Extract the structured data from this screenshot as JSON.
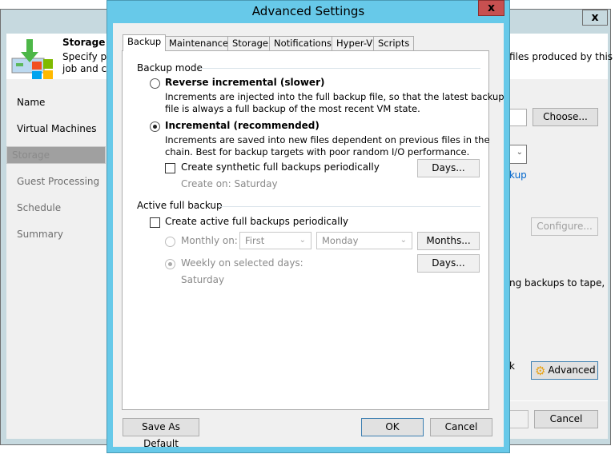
{
  "wizard": {
    "close_label": "x",
    "header_title": "Storage",
    "header_desc_line1": "Specify pr",
    "header_desc_line2": "job and cu",
    "header_desc_right": "files produced by this",
    "nav": [
      "Name",
      "Virtual Machines",
      "Storage",
      "Guest Processing",
      "Schedule",
      "Summary"
    ],
    "choose_label": "Choose...",
    "link_partial": "kup",
    "configure_label": "Configure...",
    "tape_text": "ng backups to tape,",
    "k_text": "k",
    "advanced_label": "Advanced",
    "cancel_label": "Cancel"
  },
  "dialog": {
    "title": "Advanced Settings",
    "close_label": "x",
    "tabs": [
      "Backup",
      "Maintenance",
      "Storage",
      "Notifications",
      "Hyper-V",
      "Scripts"
    ],
    "backup_mode_label": "Backup mode",
    "reverse_label": "Reverse incremental (slower)",
    "reverse_desc1": "Increments are injected into the full backup file, so that the latest backup",
    "reverse_desc2": "file is always a full backup of the most recent VM state.",
    "incremental_label": "Incremental (recommended)",
    "incremental_desc1": "Increments are saved into new files dependent on previous files in the",
    "incremental_desc2": "chain. Best for backup targets with poor random I/O performance.",
    "synthetic_label": "Create synthetic full backups periodically",
    "synthetic_days": "Days...",
    "create_on": "Create on:  Saturday",
    "active_full_label": "Active full backup",
    "active_chk_label": "Create active full backups periodically",
    "monthly_label": "Monthly on:",
    "monthly_week": "First",
    "monthly_day": "Monday",
    "months_btn": "Months...",
    "weekly_label": "Weekly on selected days:",
    "weekly_days_btn": "Days...",
    "weekly_value": "Saturday",
    "save_default": "Save As Default",
    "ok": "OK",
    "cancel": "Cancel"
  }
}
